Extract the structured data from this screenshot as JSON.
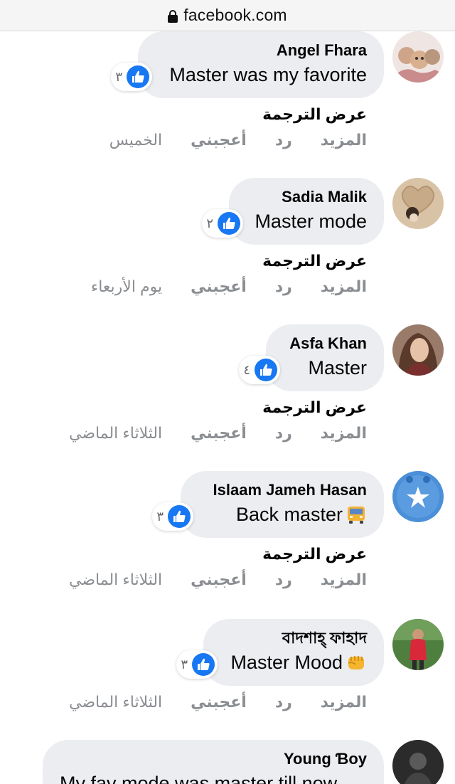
{
  "browser": {
    "url": "facebook.com"
  },
  "comments": [
    {
      "author": "Angel Fhara",
      "text": "Master was my favorite",
      "reactions": "٣",
      "translate": "عرض الترجمة",
      "time": "الخميس",
      "like": "أعجبني",
      "reply": "رد",
      "more": "المزيد"
    },
    {
      "author": "Sadia Malik",
      "text": "Master mode",
      "reactions": "٢",
      "translate": "عرض الترجمة",
      "time": "يوم الأربعاء",
      "like": "أعجبني",
      "reply": "رد",
      "more": "المزيد"
    },
    {
      "author": "Asfa Khan",
      "text": "Master",
      "reactions": "٤",
      "translate": "عرض الترجمة",
      "time": "الثلاثاء الماضي",
      "like": "أعجبني",
      "reply": "رد",
      "more": "المزيد"
    },
    {
      "author": "Islaam Jameh Hasan",
      "text": "Back master",
      "emoji": "bus-emoji",
      "reactions": "٣",
      "translate": "عرض الترجمة",
      "time": "الثلاثاء الماضي",
      "like": "أعجبني",
      "reply": "رد",
      "more": "المزيد"
    },
    {
      "author": "বাদশাহ্ ফাহাদ",
      "text": "Master Mood",
      "emoji": "fist-emoji",
      "reactions": "٣",
      "translate": "عرض الترجمة",
      "time": "الثلاثاء الماضي",
      "like": "أعجبني",
      "reply": "رد",
      "more": "المزيد"
    },
    {
      "author": "Young Ɓoy",
      "text": "My fav mode was master till now"
    }
  ],
  "colors": {
    "like_blue": "#1877f2",
    "bubble": "#ebedf0",
    "meta": "#8a8d91"
  }
}
